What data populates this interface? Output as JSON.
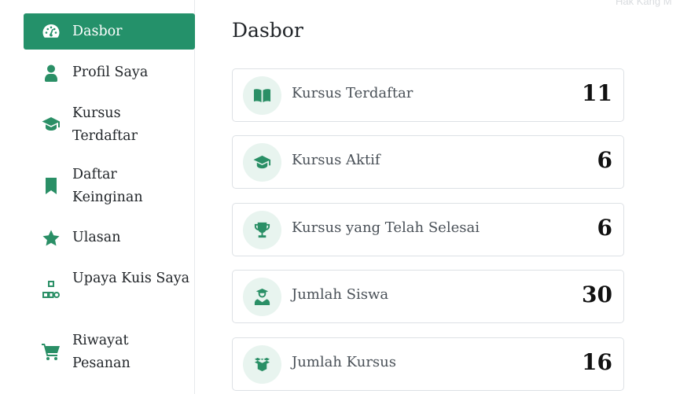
{
  "watermark": "Hak Kang M",
  "sidebar": {
    "items": [
      {
        "label": "Dasbor",
        "icon": "dashboard-icon",
        "active": true
      },
      {
        "label": "Profil Saya",
        "icon": "user-icon"
      },
      {
        "label": "Kursus Terdaftar",
        "icon": "graduation-cap-icon"
      },
      {
        "label": "Daftar Keinginan",
        "icon": "bookmark-icon"
      },
      {
        "label": "Ulasan",
        "icon": "star-icon"
      },
      {
        "label": "Upaya Kuis Saya",
        "icon": "shapes-icon"
      },
      {
        "label": "Riwayat Pesanan",
        "icon": "cart-icon"
      }
    ]
  },
  "main": {
    "title": "Dasbor",
    "stats": [
      {
        "label": "Kursus Terdaftar",
        "value": "11",
        "icon": "book-open-icon"
      },
      {
        "label": "Kursus Aktif",
        "value": "6",
        "icon": "graduation-cap-icon"
      },
      {
        "label": "Kursus yang Telah Selesai",
        "value": "6",
        "icon": "trophy-icon"
      },
      {
        "label": "Jumlah Siswa",
        "value": "30",
        "icon": "student-icon"
      },
      {
        "label": "Jumlah Kursus",
        "value": "16",
        "icon": "box-icon"
      }
    ]
  },
  "colors": {
    "accent": "#24916a",
    "icon_bg": "#e8f4ef"
  }
}
